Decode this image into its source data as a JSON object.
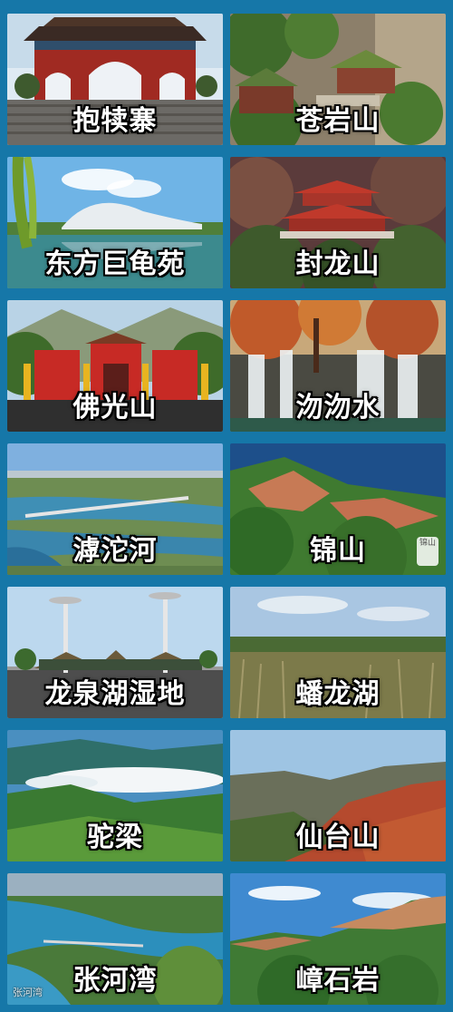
{
  "tiles": [
    {
      "label": "抱犊寨"
    },
    {
      "label": "苍岩山"
    },
    {
      "label": "东方巨龟苑"
    },
    {
      "label": "封龙山"
    },
    {
      "label": "佛光山"
    },
    {
      "label": "沕沕水"
    },
    {
      "label": "滹沱河"
    },
    {
      "label": "锦山"
    },
    {
      "label": "龙泉湖湿地"
    },
    {
      "label": "蟠龙湖"
    },
    {
      "label": "驼梁"
    },
    {
      "label": "仙台山"
    },
    {
      "label": "张河湾"
    },
    {
      "label": "嶂石岩"
    }
  ],
  "watermark": "张河湾",
  "seal_text": "锦山",
  "colors": {
    "background": "#1677a8",
    "label_text": "#ffffff",
    "label_outline": "#000000"
  }
}
